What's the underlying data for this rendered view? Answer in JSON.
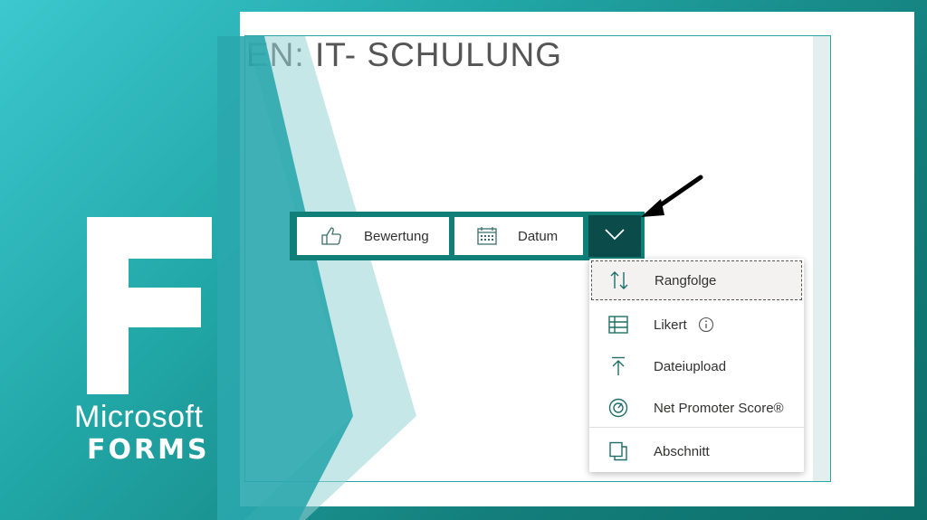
{
  "form": {
    "title": "EN: IT- SCHULUNG"
  },
  "toolbar": {
    "bewertung_label": "Bewertung",
    "datum_label": "Datum",
    "more_icon": "chevron-down-icon"
  },
  "menu": {
    "items": [
      {
        "label": "Rangfolge",
        "icon": "sort-arrows-icon",
        "selected": true
      },
      {
        "label": "Likert",
        "icon": "table-grid-icon",
        "info": true
      },
      {
        "label": "Dateiupload",
        "icon": "upload-icon"
      },
      {
        "label": "Net Promoter Score®",
        "icon": "gauge-icon"
      },
      {
        "label": "Abschnitt",
        "icon": "section-copy-icon"
      }
    ]
  },
  "logo": {
    "letter": "F",
    "brand": "Microsoft",
    "product": "FORMS"
  },
  "colors": {
    "accent": "#0f7f77",
    "accent_dark": "#0b4c4a",
    "bg_light": "#3cc8cf",
    "bg_dark": "#0d6f6a"
  }
}
